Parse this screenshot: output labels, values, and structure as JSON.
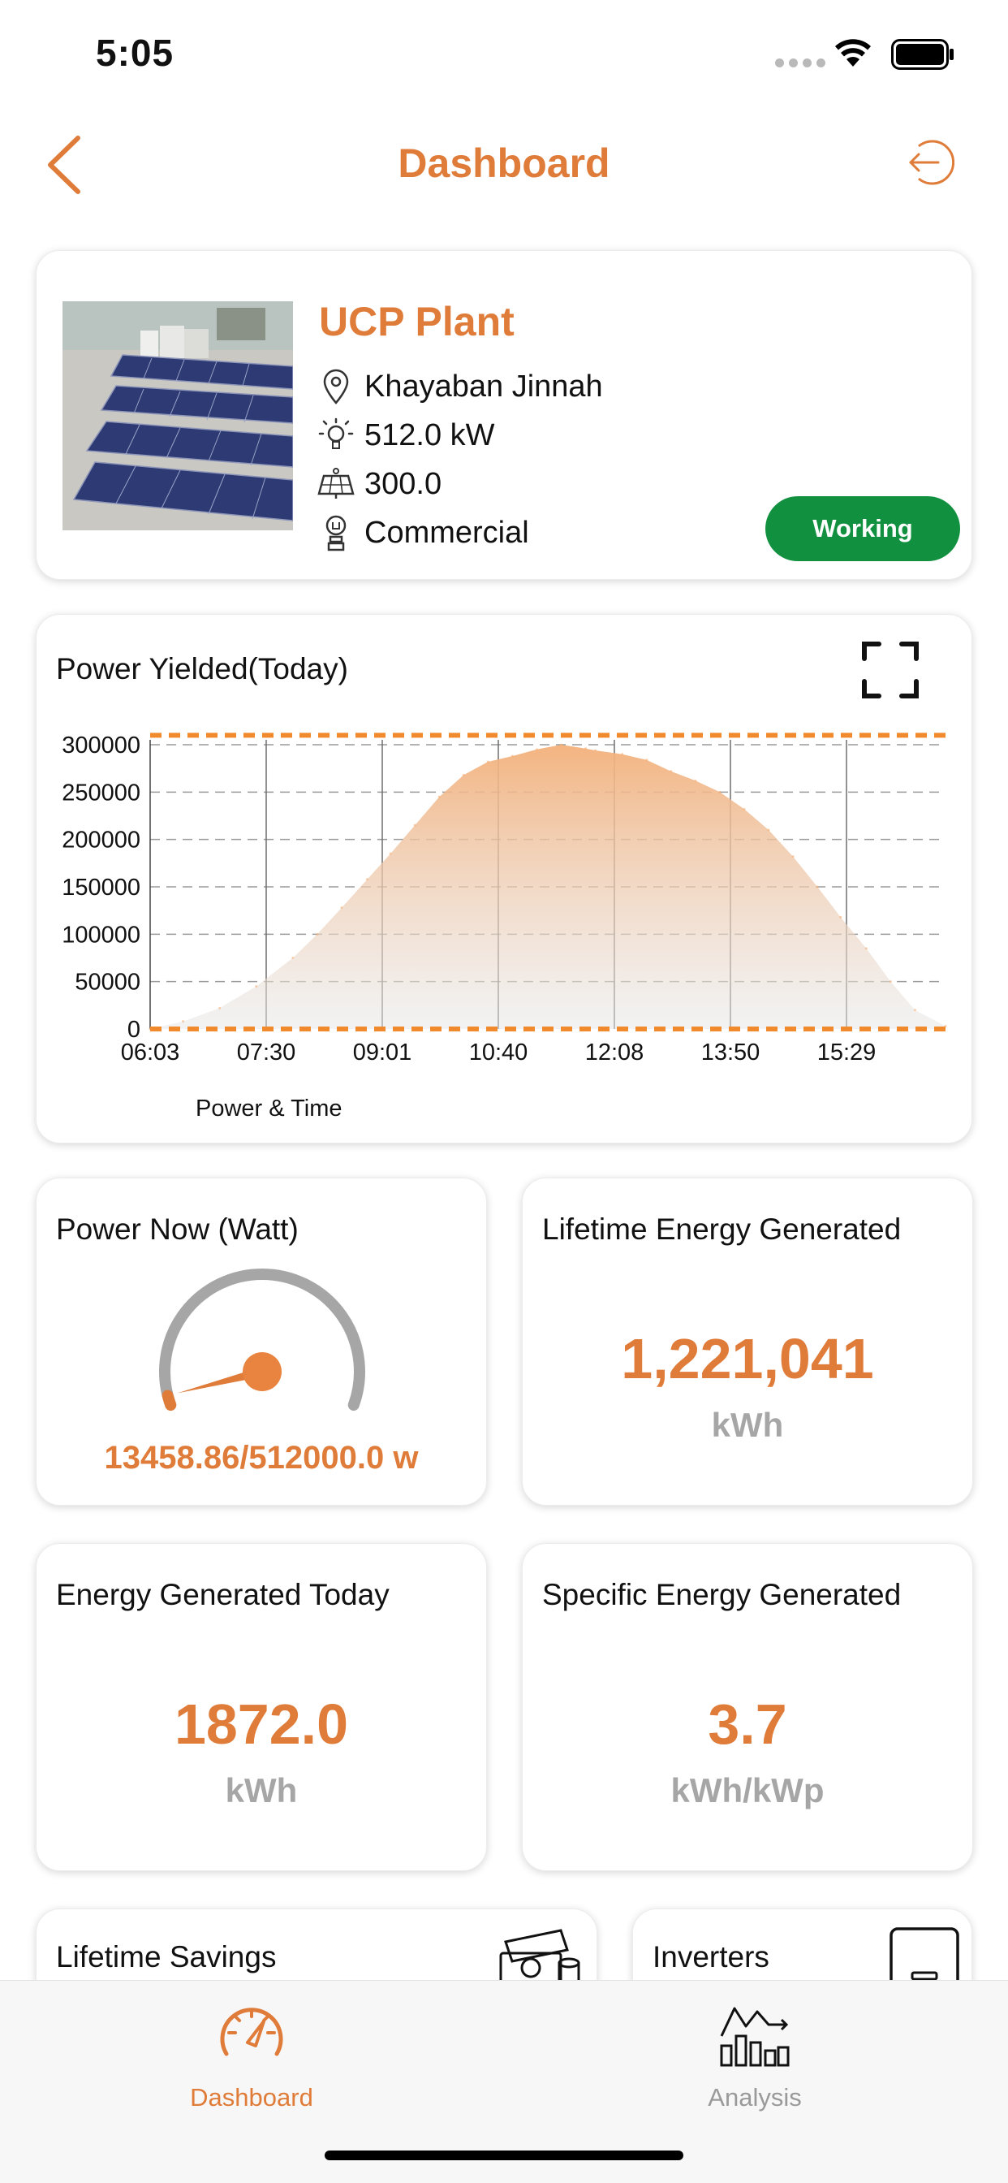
{
  "status_bar": {
    "time": "5:05"
  },
  "header": {
    "title": "Dashboard"
  },
  "plant": {
    "name": "UCP Plant",
    "location": "Khayaban Jinnah",
    "capacity": "512.0 kW",
    "panels": "300.0",
    "type": "Commercial",
    "status": "Working",
    "status_color": "#11913f"
  },
  "chart": {
    "title": "Power Yielded(Today)",
    "footer": "Power & Time"
  },
  "chart_data": {
    "type": "area",
    "x_labels": [
      "06:03",
      "07:30",
      "09:01",
      "10:40",
      "12:08",
      "13:50",
      "15:29"
    ],
    "y_ticks": [
      0,
      50000,
      100000,
      150000,
      200000,
      250000,
      300000
    ],
    "ylim": [
      0,
      300000
    ],
    "limit_lines": [
      0,
      310000
    ],
    "xlabel": "Power & Time",
    "grid": true,
    "color": "#f3b07a",
    "x": [
      "06:03",
      "06:30",
      "07:00",
      "07:30",
      "08:00",
      "08:20",
      "08:40",
      "09:01",
      "09:20",
      "09:40",
      "10:00",
      "10:20",
      "10:40",
      "11:00",
      "11:20",
      "11:40",
      "12:00",
      "12:08",
      "12:30",
      "12:50",
      "13:10",
      "13:30",
      "13:50",
      "14:10",
      "14:30",
      "14:50",
      "15:10",
      "15:29",
      "15:50",
      "16:10",
      "16:30",
      "16:55"
    ],
    "values": [
      0,
      8000,
      22000,
      45000,
      75000,
      100000,
      128000,
      158000,
      185000,
      215000,
      245000,
      268000,
      282000,
      288000,
      295000,
      300000,
      296000,
      294000,
      290000,
      284000,
      272000,
      262000,
      250000,
      232000,
      210000,
      182000,
      150000,
      118000,
      85000,
      50000,
      20000,
      3000
    ]
  },
  "power_now": {
    "title": "Power Now (Watt)",
    "reading": "13458.86/512000.0 w",
    "fraction": 0.0263
  },
  "lifetime_energy": {
    "title": "Lifetime Energy Generated",
    "value": "1,221,041",
    "unit": "kWh"
  },
  "energy_today": {
    "title": "Energy Generated Today",
    "value": "1872.0",
    "unit": "kWh"
  },
  "specific_energy": {
    "title": "Specific Energy Generated",
    "value": "3.7",
    "unit": "kWh/kWp"
  },
  "lifetime_savings": {
    "title": "Lifetime Savings"
  },
  "inverters": {
    "title": "Inverters"
  },
  "tabs": [
    {
      "label": "Dashboard",
      "active": true,
      "icon": "speedometer-icon"
    },
    {
      "label": "Analysis",
      "active": false,
      "icon": "analysis-chart-icon"
    }
  ],
  "colors": {
    "accent": "#e07c3a",
    "inactive": "#9a9a9a",
    "working": "#11913f"
  }
}
